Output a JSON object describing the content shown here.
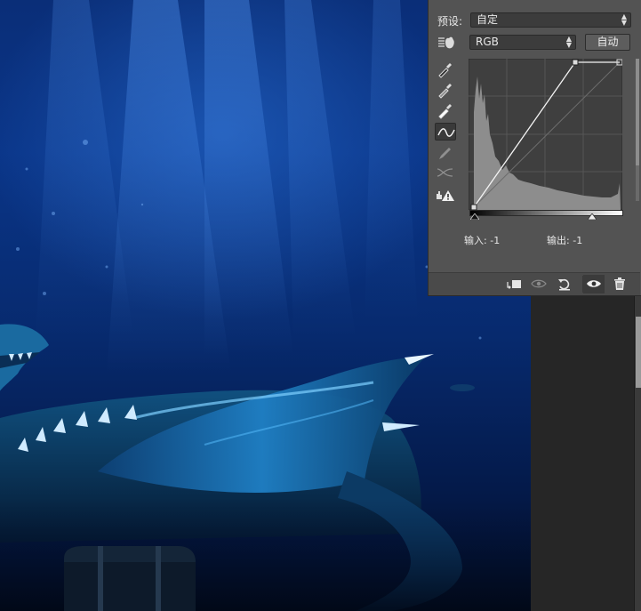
{
  "panel": {
    "preset_label": "预设:",
    "preset_value": "自定",
    "channel_value": "RGB",
    "auto_label": "自动",
    "input_label": "输入:",
    "input_value": "-1",
    "output_label": "输出:",
    "output_value": "-1"
  },
  "colors": {
    "panel_bg": "#535353",
    "canvas_deep": "#0a2e78",
    "highlight_cyan": "#3fb6ff"
  },
  "icons": [
    "hand-icon",
    "eyedropper-black-icon",
    "eyedropper-gray-icon",
    "eyedropper-white-icon",
    "curve-tool-icon",
    "pencil-icon",
    "smooth-icon",
    "histogram-warning-icon",
    "clip-to-layer-icon",
    "view-previous-icon",
    "reset-icon",
    "visibility-eye-icon",
    "trash-icon"
  ]
}
